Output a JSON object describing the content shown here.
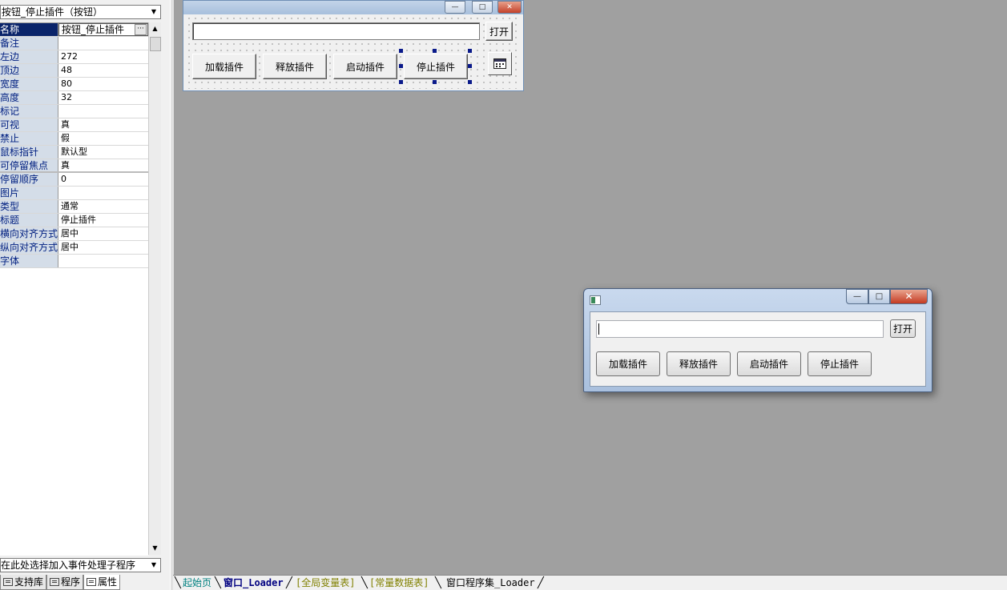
{
  "object_selector": {
    "value": "按钮_停止插件（按钮）"
  },
  "properties": [
    {
      "name": "名称",
      "value": "按钮_停止插件",
      "selected": true
    },
    {
      "name": "备注",
      "value": ""
    },
    {
      "name": "左边",
      "value": "272"
    },
    {
      "name": "顶边",
      "value": "48"
    },
    {
      "name": "宽度",
      "value": "80"
    },
    {
      "name": "高度",
      "value": "32"
    },
    {
      "name": "标记",
      "value": ""
    },
    {
      "name": "可视",
      "value": "真"
    },
    {
      "name": "禁止",
      "value": "假"
    },
    {
      "name": "鼠标指针",
      "value": "默认型"
    },
    {
      "name": "可停留焦点",
      "value": "真"
    },
    {
      "name": "  停留顺序",
      "value": "0"
    },
    {
      "name": "图片",
      "value": ""
    },
    {
      "name": "类型",
      "value": "通常"
    },
    {
      "name": "标题",
      "value": "停止插件"
    },
    {
      "name": "横向对齐方式",
      "value": "居中"
    },
    {
      "name": "纵向对齐方式",
      "value": "居中"
    },
    {
      "name": "字体",
      "value": ""
    }
  ],
  "ellipsis_label": "···",
  "event_selector": {
    "value": "在此处选择加入事件处理子程序"
  },
  "panel_tabs": [
    {
      "label": "支持库"
    },
    {
      "label": "程序"
    },
    {
      "label": "属性"
    }
  ],
  "design_form": {
    "open_button": "打开",
    "buttons": [
      "加载插件",
      "释放插件",
      "启动插件",
      "停止插件"
    ]
  },
  "preview_window": {
    "open_button": "打开",
    "buttons": [
      "加载插件",
      "释放插件",
      "启动插件",
      "停止插件"
    ]
  },
  "window_controls": {
    "minimize": "—",
    "maximize": "□",
    "close": "✕"
  },
  "bottom_tabs": [
    {
      "label": "起始页",
      "color": "#008080"
    },
    {
      "label": "窗口_Loader",
      "color": "#000080",
      "active": true
    },
    {
      "label": "[全局变量表]",
      "color": "#808000"
    },
    {
      "label": "[常量数据表]",
      "color": "#808000"
    },
    {
      "label": "窗口程序集_Loader",
      "color": "#000000"
    }
  ],
  "colors": {
    "workspace": "#a0a0a0",
    "selection": "#0a246a",
    "property_name_text": "#001f80"
  }
}
